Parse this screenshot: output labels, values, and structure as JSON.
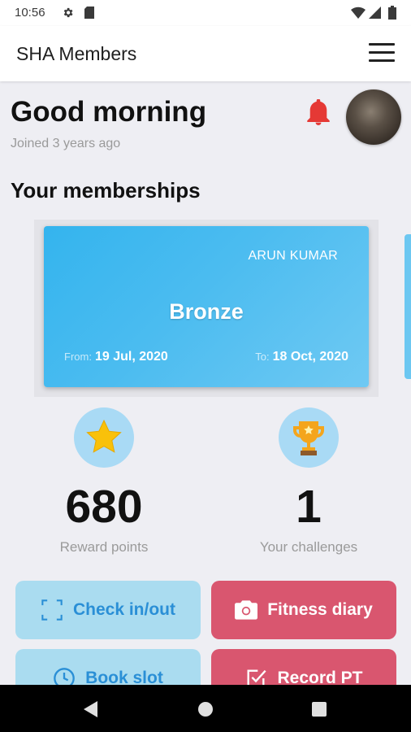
{
  "status_bar": {
    "time": "10:56",
    "icons": [
      "gear-icon",
      "sd-card-icon",
      "wifi-icon",
      "signal-icon",
      "battery-icon"
    ]
  },
  "app_bar": {
    "title": "SHA Members",
    "menu_icon": "hamburger-menu-icon"
  },
  "header": {
    "greeting": "Good morning",
    "joined": "Joined 3 years ago",
    "notification_icon": "bell-icon",
    "bell_color": "#e53935"
  },
  "memberships": {
    "title": "Your memberships",
    "card": {
      "holder_name": "ARUN KUMAR",
      "tier": "Bronze",
      "from_label": "From:",
      "from_date": "19 Jul, 2020",
      "to_label": "To:",
      "to_date": "18 Oct, 2020",
      "color": "#34b4ee"
    }
  },
  "stats": [
    {
      "icon": "star-icon",
      "value": "680",
      "label": "Reward points"
    },
    {
      "icon": "trophy-icon",
      "value": "1",
      "label": "Your challenges"
    }
  ],
  "actions": [
    {
      "icon": "scan-frame-icon",
      "label": "Check in/out",
      "color": "#aadcf0"
    },
    {
      "icon": "camera-icon",
      "label": "Fitness diary",
      "color": "#d9566f"
    },
    {
      "icon": "clock-icon",
      "label": "Book slot",
      "color": "#aadcf0"
    },
    {
      "icon": "checkbox-icon",
      "label": "Record PT",
      "color": "#d9566f"
    }
  ],
  "nav_bar": {
    "buttons": [
      "back-icon",
      "home-icon",
      "recents-icon"
    ]
  }
}
